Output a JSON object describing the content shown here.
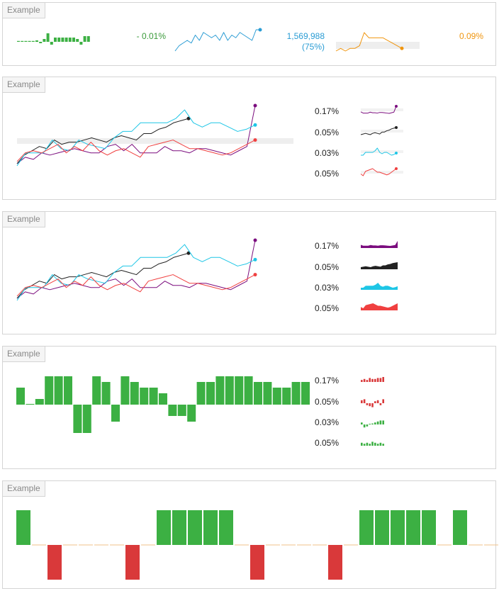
{
  "tab_label": "Example",
  "panel1": {
    "bars_color": "#3cb043",
    "bars_values": [
      0,
      0,
      0,
      0,
      0,
      1,
      -1,
      2,
      6,
      -2,
      3,
      3,
      3,
      3,
      3,
      3,
      2,
      -2,
      4,
      4
    ],
    "label1": "- 0.01%",
    "label1_color": "#3a9a3a",
    "line1_values": [
      3,
      5,
      6,
      7,
      6,
      9,
      7,
      10,
      9,
      8,
      9,
      7,
      10,
      7,
      9,
      8,
      10,
      9,
      8,
      7,
      11,
      11
    ],
    "line1_color": "#2a9cd4",
    "label2_a": "1,569,988",
    "label2_b": "(75%)",
    "label2_color": "#2a9cd4",
    "line2_values": [
      2,
      3,
      2,
      3,
      3,
      4,
      9,
      7,
      7,
      7,
      7,
      6,
      5,
      4,
      3
    ],
    "line2_color": "#f0950e",
    "label3": "0.09%",
    "label3_color": "#f0950e"
  },
  "multi": {
    "series": [
      {
        "color": "#7b0d7e",
        "values": [
          3,
          6,
          5,
          8,
          7,
          8,
          9,
          10,
          9,
          8,
          8,
          11,
          12,
          9,
          12,
          8,
          8,
          8,
          11,
          9,
          9,
          8,
          10,
          10,
          9,
          8,
          7,
          9,
          11,
          30
        ]
      },
      {
        "color": "#222222",
        "values": [
          3,
          7,
          9,
          11,
          10,
          14,
          12,
          13,
          13,
          14,
          15,
          14,
          13,
          15,
          16,
          15,
          14,
          17,
          17,
          19,
          20,
          22,
          23,
          24
        ]
      },
      {
        "color": "#1ec6e6",
        "values": [
          2,
          8,
          8,
          8,
          14,
          10,
          9,
          14,
          12,
          11,
          10,
          15,
          18,
          18,
          22,
          22,
          22,
          22,
          24,
          28,
          22,
          20,
          22,
          22,
          20,
          18,
          19,
          21
        ]
      },
      {
        "color": "#f04040",
        "values": [
          4,
          8,
          9,
          8,
          10,
          12,
          8,
          11,
          9,
          13,
          9,
          7,
          9,
          10,
          8,
          6,
          11,
          12,
          13,
          14,
          12,
          10,
          10,
          9,
          8,
          7,
          8,
          10,
          12,
          14
        ]
      }
    ],
    "legend": [
      "0.17%",
      "0.05%",
      "0.03%",
      "0.05%"
    ]
  },
  "bars3": {
    "values": [
      3,
      0,
      1,
      5,
      5,
      5,
      -5,
      -5,
      5,
      4,
      -3,
      5,
      4,
      3,
      3,
      2,
      -2,
      -2,
      -3,
      4,
      4,
      5,
      5,
      5,
      5,
      4,
      4,
      3,
      3,
      4,
      4
    ],
    "pos_color": "#3cb043",
    "neg_color": "#3cb043",
    "legend": [
      "0.17%",
      "0.05%",
      "0.03%",
      "0.05%"
    ],
    "legend_colors": [
      "#d9393a",
      "#d9393a",
      "#3cb043",
      "#3cb043"
    ]
  },
  "bars4": {
    "values": [
      1,
      0,
      -1,
      0,
      0,
      0,
      0,
      -1,
      0,
      1,
      1,
      1,
      1,
      1,
      0,
      -1,
      0,
      0,
      0,
      0,
      -1,
      0,
      1,
      1,
      1,
      1,
      1,
      0,
      1,
      0,
      0
    ],
    "pos_color": "#3cb043",
    "neg_color": "#d9393a",
    "zero_color": "#f0c088"
  }
}
